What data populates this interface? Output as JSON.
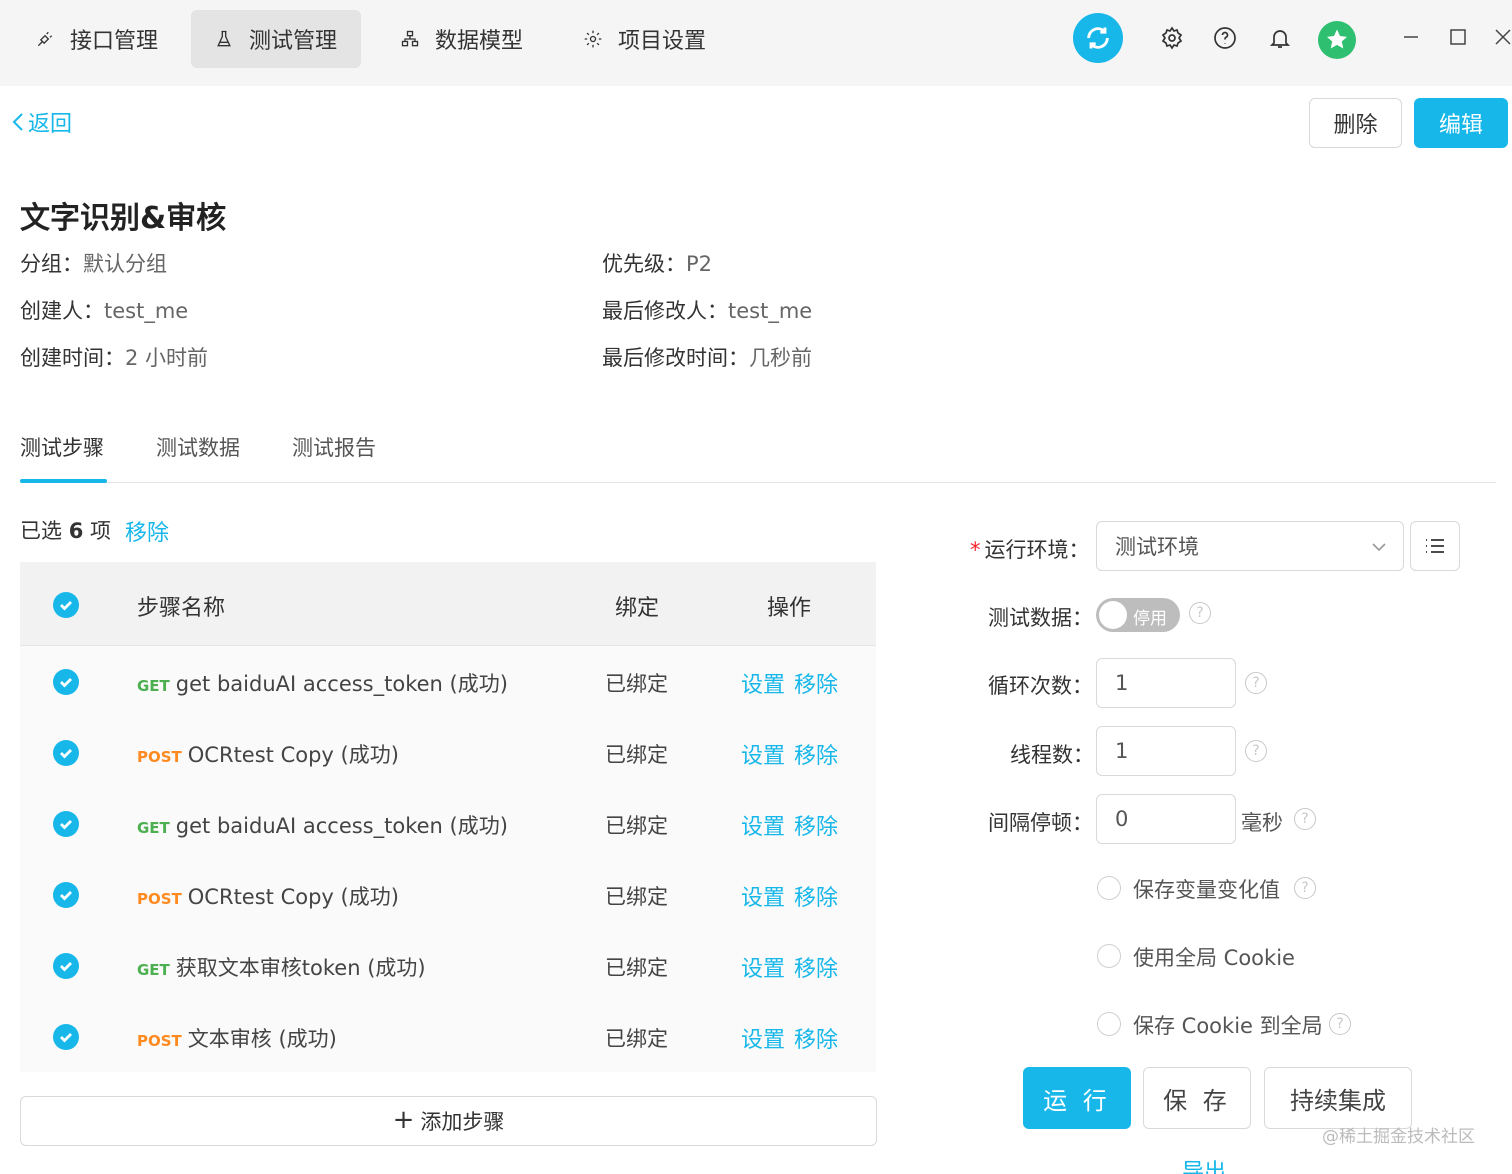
{
  "nav": {
    "tabs": [
      {
        "label": "接口管理",
        "icon": "api-icon",
        "active": false
      },
      {
        "label": "测试管理",
        "icon": "flask-icon",
        "active": true
      },
      {
        "label": "数据模型",
        "icon": "model-icon",
        "active": false
      },
      {
        "label": "项目设置",
        "icon": "gear-icon",
        "active": false
      }
    ]
  },
  "toolbar": {
    "sync_icon": "sync-icon",
    "settings_icon": "gear-icon",
    "help_icon": "help-icon",
    "bell_icon": "bell-icon",
    "avatar_icon": "avatar"
  },
  "header": {
    "back_label": "返回",
    "delete_label": "删除",
    "edit_label": "编辑"
  },
  "case": {
    "title": "文字识别&审核",
    "group_label": "分组：",
    "group_value": "默认分组",
    "priority_label": "优先级：",
    "priority_value": "P2",
    "creator_label": "创建人：",
    "creator_value": "test_me",
    "modifier_label": "最后修改人：",
    "modifier_value": "test_me",
    "created_label": "创建时间：",
    "created_value": "2 小时前",
    "modified_label": "最后修改时间：",
    "modified_value": "几秒前"
  },
  "tabs": [
    {
      "label": "测试步骤",
      "active": true
    },
    {
      "label": "测试数据",
      "active": false
    },
    {
      "label": "测试报告",
      "active": false
    }
  ],
  "selection": {
    "prefix": "已选",
    "count": "6",
    "suffix": "项",
    "remove_label": "移除"
  },
  "table": {
    "headers": {
      "name": "步骤名称",
      "bind": "绑定",
      "action": "操作"
    },
    "rows": [
      {
        "method": "GET",
        "name": "get baiduAI access_token (成功)",
        "bind": "已绑定",
        "set": "设置",
        "remove": "移除"
      },
      {
        "method": "POST",
        "name": "OCRtest Copy (成功)",
        "bind": "已绑定",
        "set": "设置",
        "remove": "移除"
      },
      {
        "method": "GET",
        "name": "get baiduAI access_token (成功)",
        "bind": "已绑定",
        "set": "设置",
        "remove": "移除"
      },
      {
        "method": "POST",
        "name": "OCRtest Copy (成功)",
        "bind": "已绑定",
        "set": "设置",
        "remove": "移除"
      },
      {
        "method": "GET",
        "name": "获取文本审核token (成功)",
        "bind": "已绑定",
        "set": "设置",
        "remove": "移除"
      },
      {
        "method": "POST",
        "name": "文本审核 (成功)",
        "bind": "已绑定",
        "set": "设置",
        "remove": "移除"
      }
    ],
    "add_step_label": "添加步骤"
  },
  "run_panel": {
    "env_label": "运行环境：",
    "env_value": "测试环境",
    "test_data_label": "测试数据：",
    "test_data_toggle": "停用",
    "loop_label": "循环次数：",
    "loop_value": "1",
    "threads_label": "线程数：",
    "threads_value": "1",
    "interval_label": "间隔停顿：",
    "interval_value": "0",
    "interval_unit": "毫秒",
    "opt_save_vars": "保存变量变化值",
    "opt_global_cookie": "使用全局 Cookie",
    "opt_save_cookie": "保存 Cookie 到全局",
    "run_label": "运 行",
    "save_label": "保 存",
    "ci_label": "持续集成",
    "export_label": "导出"
  },
  "watermark": "@稀土掘金技术社区",
  "colors": {
    "accent": "#17b7ea",
    "get": "#4caf50",
    "post": "#ff8a1f"
  }
}
